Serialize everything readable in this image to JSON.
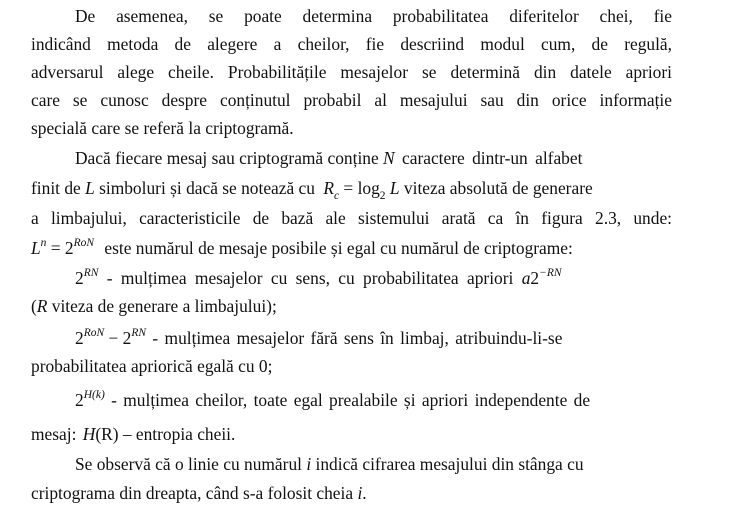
{
  "para1": {
    "l1": "De asemenea, se poate determina probabilitatea diferitelor chei, fie",
    "l2": "indicând metoda de alegere a cheilor, fie descriind modul cum, de regulă,",
    "l3": "adversarul alege cheile. Probabilitățile mesajelor se determină din datele apriori",
    "l4": "care se cunosc despre conținutul probabil al mesajului sau din orice informație",
    "l5": "specială care se referă la criptogramă."
  },
  "para2": {
    "l1a": "Dacă fiecare mesaj sau criptogramă conține ",
    "l1v": "N",
    "l1b": " caractere dintr-un alfabet",
    "l2a": "finit de ",
    "l2v": "L",
    "l2b": " simboluri și dacă se notează cu ",
    "l2f_r": "R",
    "l2f_c": "c",
    "l2f_eq": " = log",
    "l2f_2": "2",
    "l2f_L": " L",
    "l2c": " viteza absolută de generare",
    "l3": "a limbajului, caracteristicile de bază ale sistemului arată ca în figura 2.3, unde:",
    "l4f_L": "L",
    "l4f_n": "n",
    "l4f_eq": " = 2",
    "l4f_exp": "RoN",
    "l4b": " este numărul de mesaje posibile și egal cu numărul de criptograme:"
  },
  "items": {
    "i1_base": "2",
    "i1_exp": "RN",
    "i1_text": " - mulțimea mesajelor cu sens, cu probabilitatea apriori ",
    "i1_a": "a",
    "i1_2": "2",
    "i1_exp2": "−RN",
    "i1_l2a": "(",
    "i1_l2v": "R",
    "i1_l2b": " viteza de generare a limbajului);",
    "i2_base": "2",
    "i2_exp": "RoN",
    "i2_minus": " − 2",
    "i2_exp2": "RN",
    "i2_text": " - mulțimea mesajelor fără sens în limbaj, atribuindu-li-se",
    "i2_l2": "probabilitatea apriorică egală cu 0;",
    "i3_base": "2",
    "i3_exp": "H(k)",
    "i3_text": " - mulțimea cheilor, toate egal prealabile și apriori independente de",
    "i3_l2a": "mesaj: ",
    "i3_l2f": "H",
    "i3_l2f2": "(R)",
    "i3_l2b": " – entropia cheii."
  },
  "para3": {
    "l1a": "Se observă că o linie cu numărul ",
    "l1v": "i",
    "l1b": " indică cifrarea mesajului din stânga cu",
    "l2a": "criptograma din dreapta, când s-a folosit cheia ",
    "l2v": "i",
    "l2b": "."
  }
}
